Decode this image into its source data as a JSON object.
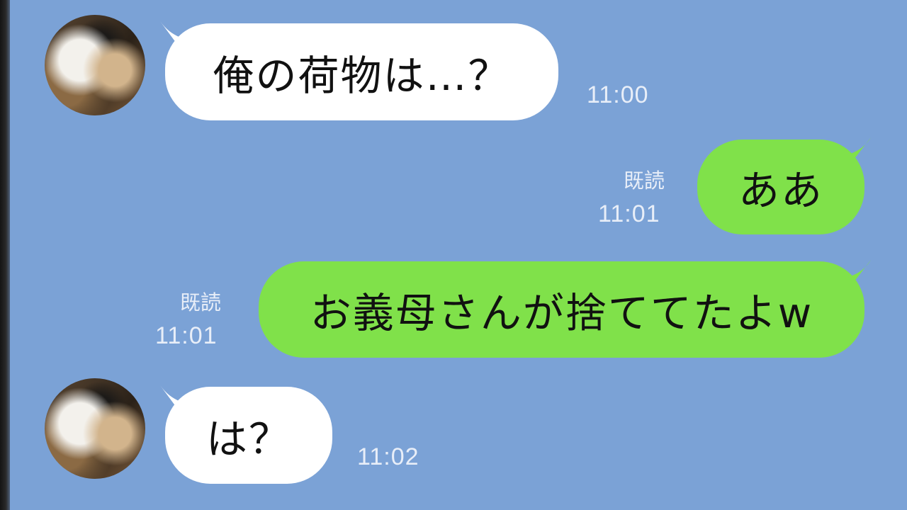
{
  "messages": [
    {
      "sender": "partner",
      "text": "俺の荷物は…？",
      "time": "11:00"
    },
    {
      "sender": "self",
      "text": "ああ",
      "time": "11:01",
      "read": "既読"
    },
    {
      "sender": "self",
      "text": "お義母さんが捨ててたよw",
      "time": "11:01",
      "read": "既読"
    },
    {
      "sender": "partner",
      "text": "は？",
      "time": "11:02"
    }
  ],
  "colors": {
    "background": "#7ba2d6",
    "incoming_bubble": "#ffffff",
    "outgoing_bubble": "#80e14a",
    "meta_text": "#e8eef8"
  },
  "icons": {
    "avatar": "panda-avatar"
  }
}
